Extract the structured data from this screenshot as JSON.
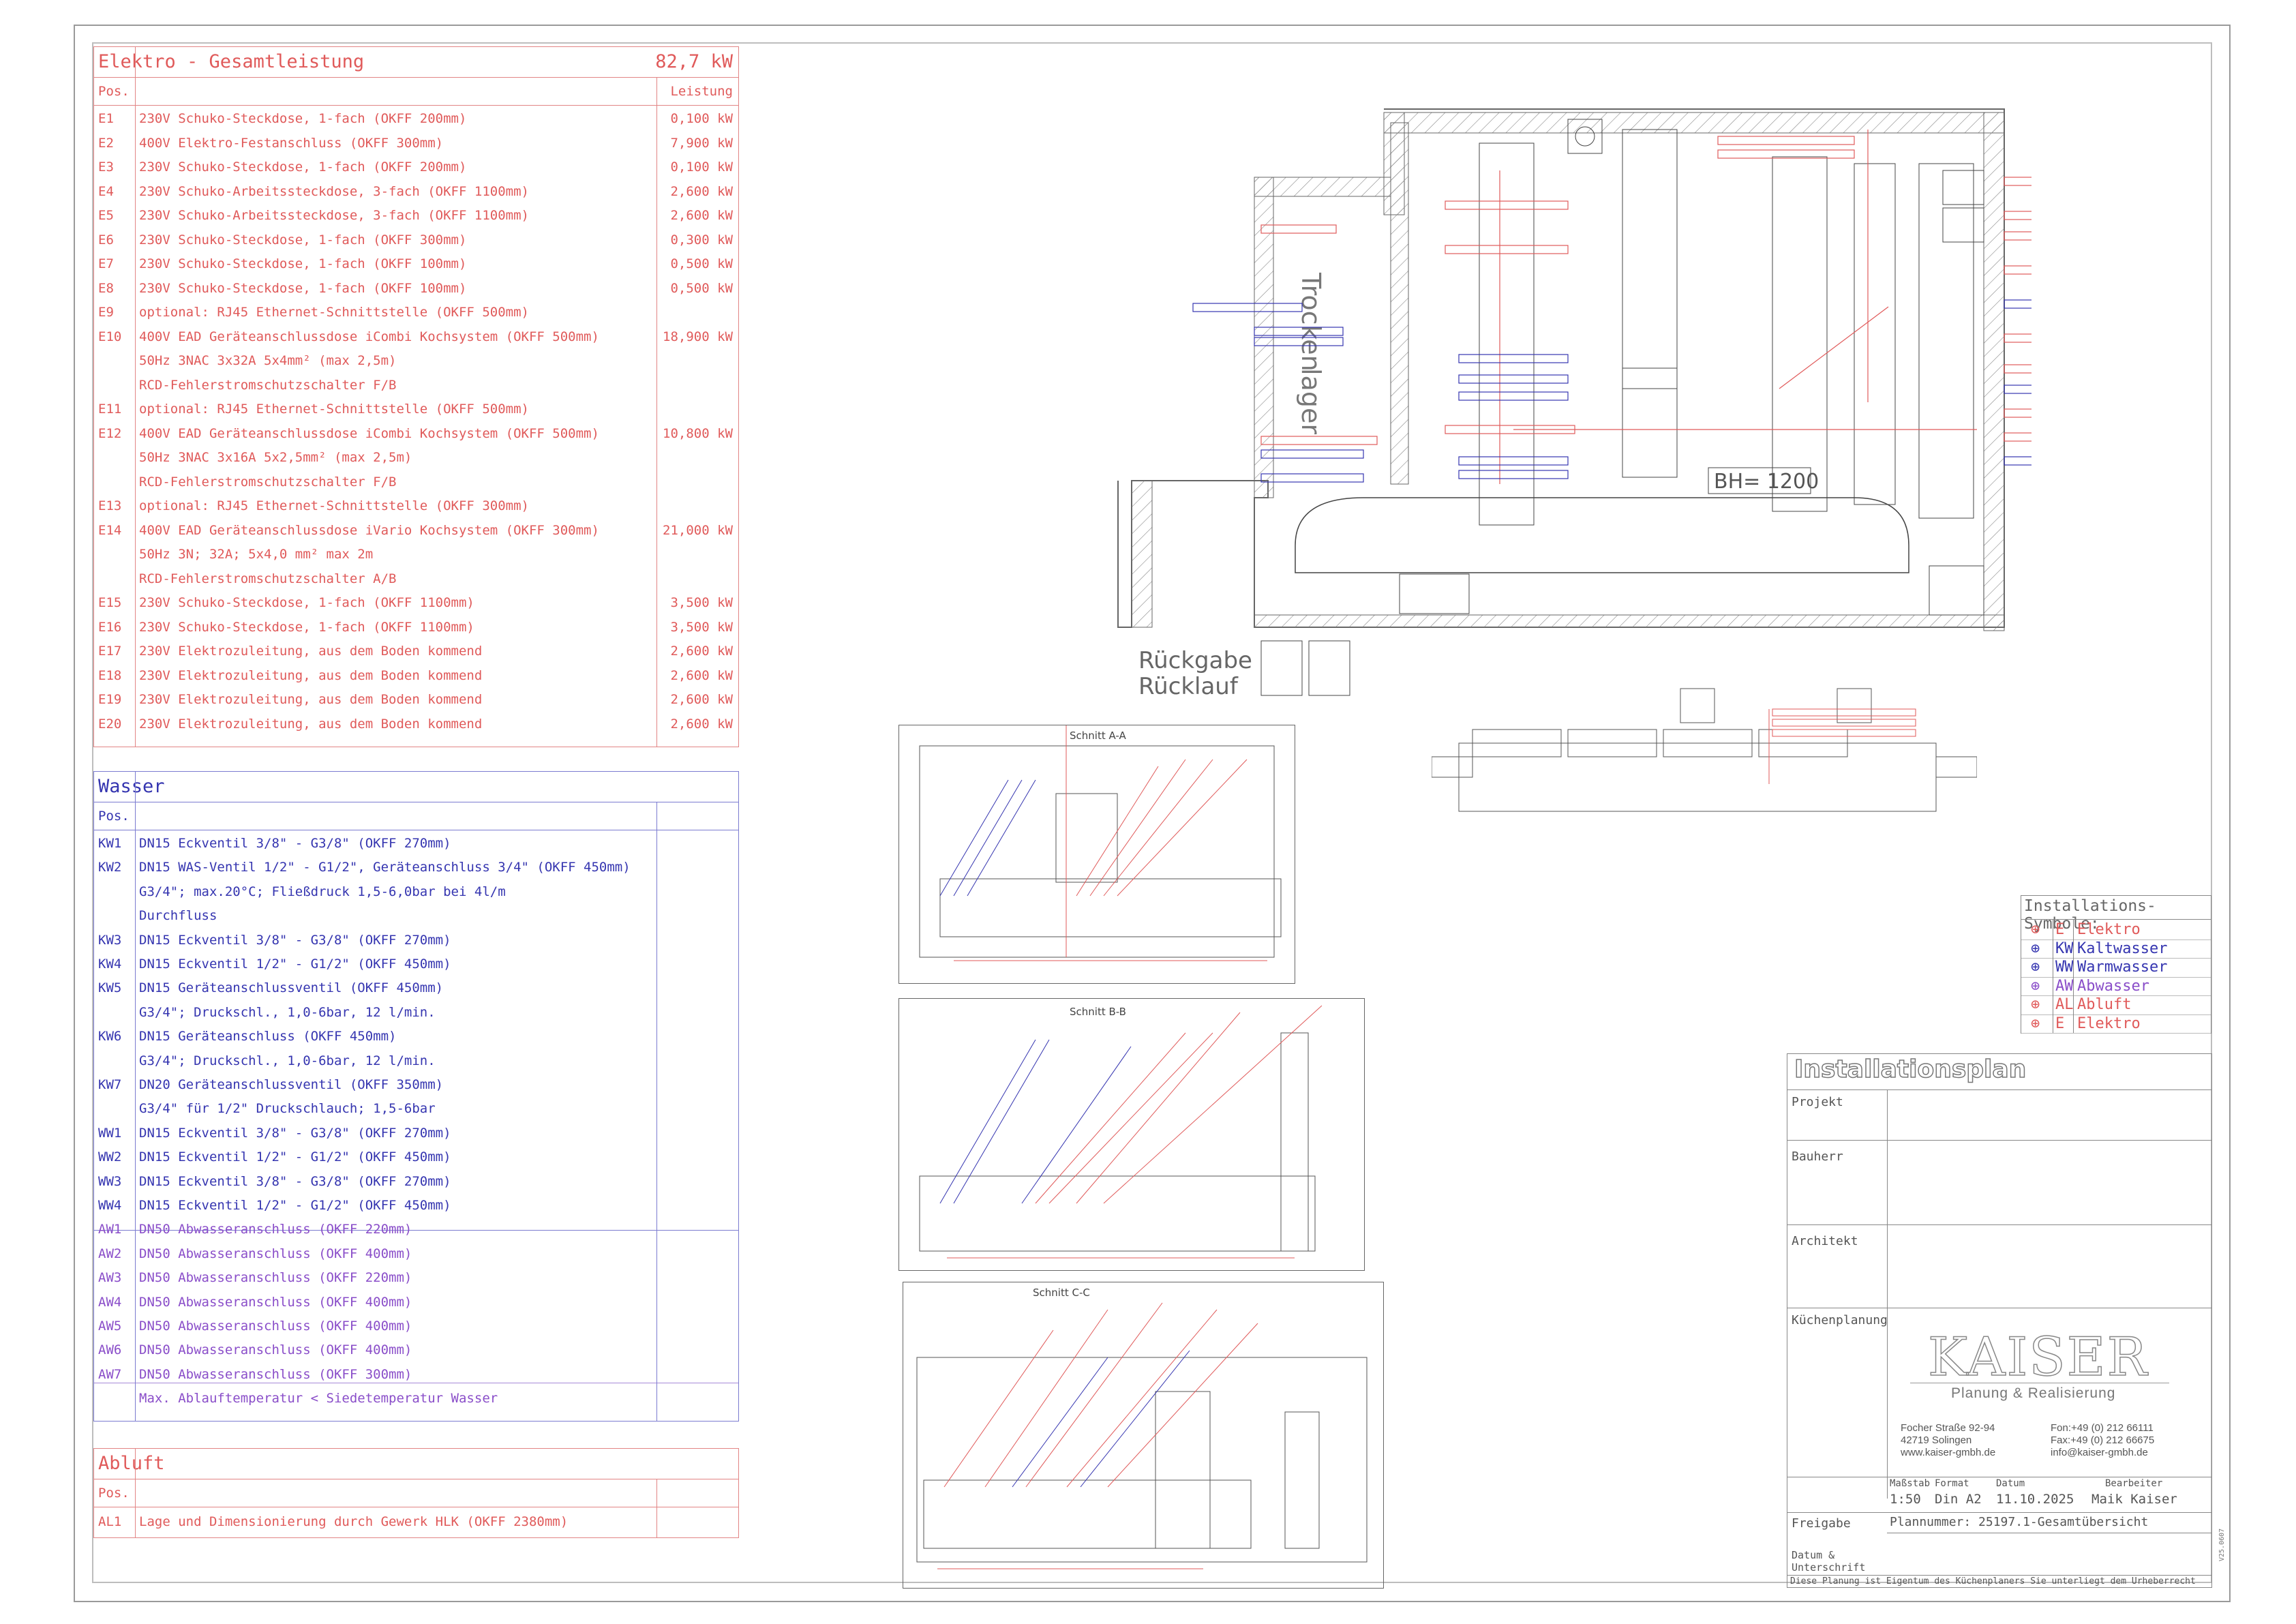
{
  "elektro": {
    "title": "Elektro - Gesamtleistung",
    "total": "82,7 kW",
    "col_pos": "Pos.",
    "col_power": "Leistung",
    "rows": [
      {
        "pos": "E1",
        "text": "230V Schuko-Steckdose, 1-fach (OKFF 200mm)",
        "power": "0,100 kW"
      },
      {
        "pos": "E2",
        "text": "400V Elektro-Festanschluss (OKFF 300mm)",
        "power": "7,900 kW"
      },
      {
        "pos": "E3",
        "text": "230V Schuko-Steckdose, 1-fach (OKFF 200mm)",
        "power": "0,100 kW"
      },
      {
        "pos": "E4",
        "text": "230V Schuko-Arbeitssteckdose, 3-fach (OKFF 1100mm)",
        "power": "2,600 kW"
      },
      {
        "pos": "E5",
        "text": "230V Schuko-Arbeitssteckdose, 3-fach (OKFF 1100mm)",
        "power": "2,600 kW"
      },
      {
        "pos": "E6",
        "text": "230V Schuko-Steckdose, 1-fach (OKFF 300mm)",
        "power": "0,300 kW"
      },
      {
        "pos": "E7",
        "text": "230V Schuko-Steckdose, 1-fach (OKFF 100mm)",
        "power": "0,500 kW"
      },
      {
        "pos": "E8",
        "text": "230V Schuko-Steckdose, 1-fach (OKFF 100mm)",
        "power": "0,500 kW"
      },
      {
        "pos": "E9",
        "text": "optional: RJ45 Ethernet-Schnittstelle (OKFF 500mm)",
        "power": ""
      },
      {
        "pos": "E10",
        "text": "400V EAD Geräteanschlussdose iCombi Kochsystem (OKFF 500mm)",
        "power": "18,900 kW"
      },
      {
        "pos": "",
        "text": "50Hz 3NAC 3x32A 5x4mm² (max 2,5m)",
        "power": ""
      },
      {
        "pos": "",
        "text": "RCD-Fehlerstromschutzschalter F/B",
        "power": ""
      },
      {
        "pos": "E11",
        "text": "optional: RJ45 Ethernet-Schnittstelle (OKFF 500mm)",
        "power": ""
      },
      {
        "pos": "E12",
        "text": "400V EAD Geräteanschlussdose iCombi Kochsystem (OKFF 500mm)",
        "power": "10,800 kW"
      },
      {
        "pos": "",
        "text": "50Hz 3NAC 3x16A 5x2,5mm² (max 2,5m)",
        "power": ""
      },
      {
        "pos": "",
        "text": "RCD-Fehlerstromschutzschalter F/B",
        "power": ""
      },
      {
        "pos": "E13",
        "text": "optional: RJ45 Ethernet-Schnittstelle (OKFF 300mm)",
        "power": ""
      },
      {
        "pos": "E14",
        "text": "400V EAD Geräteanschlussdose iVario Kochsystem (OKFF 300mm)",
        "power": "21,000 kW"
      },
      {
        "pos": "",
        "text": "50Hz 3N; 32A; 5x4,0 mm² max 2m",
        "power": ""
      },
      {
        "pos": "",
        "text": "RCD-Fehlerstromschutzschalter A/B",
        "power": ""
      },
      {
        "pos": "E15",
        "text": "230V Schuko-Steckdose, 1-fach (OKFF 1100mm)",
        "power": "3,500 kW"
      },
      {
        "pos": "E16",
        "text": "230V Schuko-Steckdose, 1-fach (OKFF 1100mm)",
        "power": "3,500 kW"
      },
      {
        "pos": "E17",
        "text": "230V Elektrozuleitung, aus dem Boden kommend",
        "power": "2,600 kW"
      },
      {
        "pos": "E18",
        "text": "230V Elektrozuleitung, aus dem Boden kommend",
        "power": "2,600 kW"
      },
      {
        "pos": "E19",
        "text": "230V Elektrozuleitung, aus dem Boden kommend",
        "power": "2,600 kW"
      },
      {
        "pos": "E20",
        "text": "230V Elektrozuleitung, aus dem Boden kommend",
        "power": "2,600 kW"
      }
    ]
  },
  "wasser": {
    "title": "Wasser",
    "col_pos": "Pos.",
    "rows": [
      {
        "pos": "KW1",
        "text": "DN15 Eckventil 3/8\" - G3/8\" (OKFF 270mm)",
        "kind": "blue"
      },
      {
        "pos": "KW2",
        "text": "DN15 WAS-Ventil 1/2\" - G1/2\", Geräteanschluss 3/4\" (OKFF 450mm)",
        "kind": "blue"
      },
      {
        "pos": "",
        "text": "G3/4\"; max.20°C; Fließdruck 1,5-6,0bar bei 4l/m",
        "kind": "blue"
      },
      {
        "pos": "",
        "text": "Durchfluss",
        "kind": "blue"
      },
      {
        "pos": "KW3",
        "text": "DN15 Eckventil 3/8\" - G3/8\" (OKFF 270mm)",
        "kind": "blue"
      },
      {
        "pos": "KW4",
        "text": "DN15 Eckventil 1/2\" - G1/2\" (OKFF 450mm)",
        "kind": "blue"
      },
      {
        "pos": "KW5",
        "text": "DN15 Geräteanschlussventil (OKFF 450mm)",
        "kind": "blue"
      },
      {
        "pos": "",
        "text": "G3/4\"; Druckschl., 1,0-6bar, 12 l/min.",
        "kind": "blue"
      },
      {
        "pos": "KW6",
        "text": "DN15 Geräteanschluss (OKFF 450mm)",
        "kind": "blue"
      },
      {
        "pos": "",
        "text": "G3/4\"; Druckschl., 1,0-6bar, 12 l/min.",
        "kind": "blue"
      },
      {
        "pos": "KW7",
        "text": "DN20 Geräteanschlussventil (OKFF 350mm)",
        "kind": "blue"
      },
      {
        "pos": "",
        "text": "G3/4\" für 1/2\" Druckschlauch; 1,5-6bar",
        "kind": "blue"
      },
      {
        "pos": "WW1",
        "text": "DN15 Eckventil 3/8\" - G3/8\" (OKFF 270mm)",
        "kind": "blue"
      },
      {
        "pos": "WW2",
        "text": "DN15 Eckventil 1/2\" - G1/2\" (OKFF 450mm)",
        "kind": "blue"
      },
      {
        "pos": "WW3",
        "text": "DN15 Eckventil 3/8\" - G3/8\" (OKFF 270mm)",
        "kind": "blue"
      },
      {
        "pos": "WW4",
        "text": "DN15 Eckventil 1/2\" - G1/2\" (OKFF 450mm)",
        "kind": "blue"
      },
      {
        "pos": "AW1",
        "text": "DN50 Abwasseranschluss (OKFF 220mm)",
        "kind": "purple"
      },
      {
        "pos": "AW2",
        "text": "DN50 Abwasseranschluss (OKFF 400mm)",
        "kind": "purple"
      },
      {
        "pos": "AW3",
        "text": "DN50 Abwasseranschluss (OKFF 220mm)",
        "kind": "purple"
      },
      {
        "pos": "AW4",
        "text": "DN50 Abwasseranschluss (OKFF 400mm)",
        "kind": "purple"
      },
      {
        "pos": "AW5",
        "text": "DN50 Abwasseranschluss (OKFF 400mm)",
        "kind": "purple"
      },
      {
        "pos": "AW6",
        "text": "DN50 Abwasseranschluss (OKFF 400mm)",
        "kind": "purple"
      },
      {
        "pos": "AW7",
        "text": "DN50 Abwasseranschluss (OKFF 300mm)",
        "kind": "purple"
      },
      {
        "pos": "",
        "text": "Max. Ablauftemperatur < Siedetemperatur Wasser",
        "kind": "purple"
      }
    ]
  },
  "abluft": {
    "title": "Abluft",
    "col_pos": "Pos.",
    "rows": [
      {
        "pos": "AL1",
        "text": "Lage und Dimensionierung durch Gewerk HLK (OKFF 2380mm)"
      }
    ]
  },
  "floorplan": {
    "room_label_1": "Trocken",
    "room_label_2": "lager",
    "bh_label": "BH= 1200",
    "return_label_1": "Rückgabe",
    "return_label_2": "Rücklauf"
  },
  "sections": {
    "a": "Schnitt A-A",
    "b": "Schnitt B-B",
    "c": "Schnitt C-C"
  },
  "symbols": {
    "title": "Installations-Symbole:",
    "rows": [
      {
        "code": "E",
        "label": "Elektro",
        "color": "#e05a5a"
      },
      {
        "code": "KW",
        "label": "Kaltwasser",
        "color": "#3535b0"
      },
      {
        "code": "WW",
        "label": "Warmwasser",
        "color": "#3535b0"
      },
      {
        "code": "AW",
        "label": "Abwasser",
        "color": "#8a4ec9"
      },
      {
        "code": "AL",
        "label": "Abluft",
        "color": "#e05a5a"
      },
      {
        "code": "E",
        "label": "Elektro",
        "color": "#e05a5a"
      }
    ]
  },
  "titleblock": {
    "heading": "Installationsplan",
    "projekt": "Projekt",
    "bauherr": "Bauherr",
    "architekt": "Architekt",
    "kuechenplanung": "Küchenplanung",
    "company": "KAISER",
    "company_sub": "Planung & Realisierung",
    "addr1": "Focher Straße 92-94",
    "addr2": "42719 Solingen",
    "addr3": "www.kaiser-gmbh.de",
    "fon": "Fon:+49 (0) 212 66111",
    "fax": "Fax:+49 (0) 212 66675",
    "mail": "info@kaiser-gmbh.de",
    "lbl_massstab": "Maßstab",
    "lbl_format": "Format",
    "lbl_datum": "Datum",
    "lbl_bearbeiter": "Bearbeiter",
    "massstab": "1:50",
    "format": "Din A2",
    "datum": "11.10.2025",
    "bearbeiter": "Maik Kaiser",
    "freigabe": "Freigabe",
    "plannummer": "Plannummer: 25197.1-Gesamtübersicht",
    "datum_unterschrift": "Datum &",
    "unterschrift": "Unterschrift",
    "footer": "Diese Planung ist Eigentum des Küchenplaners Sie unterliegt dem Urheberrecht",
    "side_code": "V25.0607"
  }
}
